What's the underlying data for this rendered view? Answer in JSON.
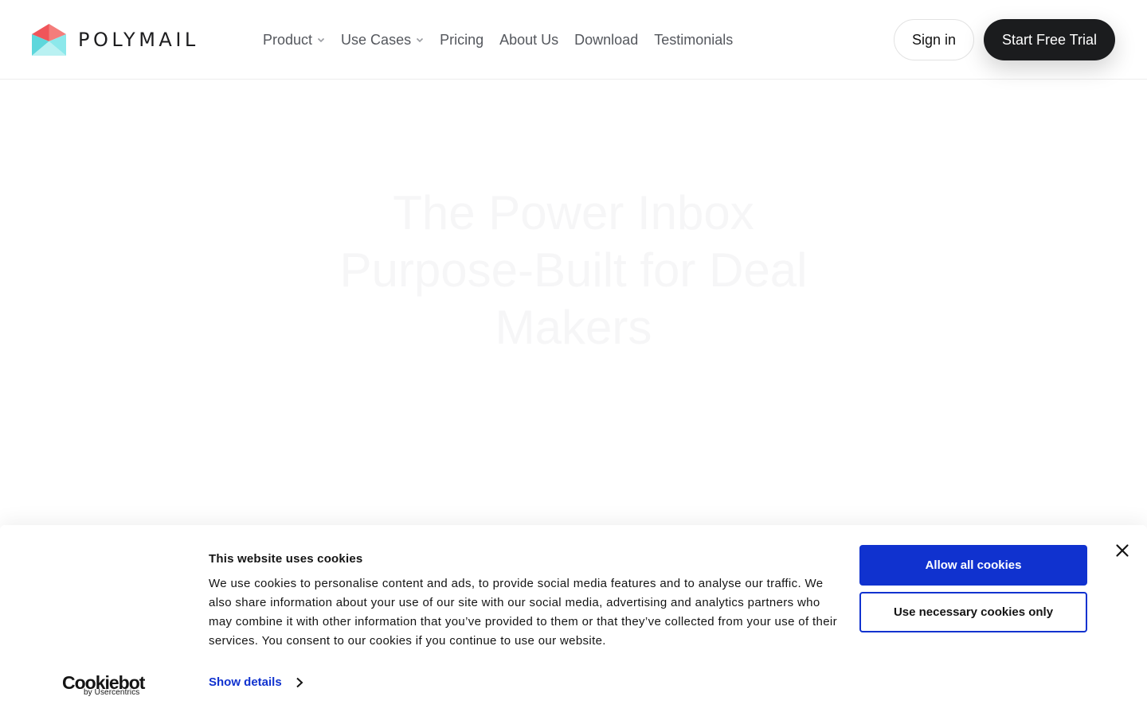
{
  "brand": {
    "name": "POLYMAIL",
    "colors": {
      "red": "#f0555a",
      "coral": "#f47d7b",
      "cyan": "#7ee6ea",
      "teal": "#5dd7dc"
    }
  },
  "nav": {
    "items": [
      {
        "label": "Product",
        "has_dropdown": true
      },
      {
        "label": "Use Cases",
        "has_dropdown": true
      },
      {
        "label": "Pricing",
        "has_dropdown": false
      },
      {
        "label": "About Us",
        "has_dropdown": false
      },
      {
        "label": "Download",
        "has_dropdown": false
      },
      {
        "label": "Testimonials",
        "has_dropdown": false
      }
    ],
    "signin_label": "Sign in",
    "trial_label": "Start Free Trial"
  },
  "hero": {
    "title": "The Power Inbox Purpose-Built for Deal Makers"
  },
  "cookie_banner": {
    "title": "This website uses cookies",
    "body": "We use cookies to personalise content and ads, to provide social media features and to analyse our traffic. We also share information about your use of our site with our social media, advertising and analytics partners who may combine it with other information that you’ve provided to them or that they’ve collected from your use of their services. You consent to our cookies if you continue to use our website.",
    "show_details_label": "Show details",
    "allow_all_label": "Allow all cookies",
    "necessary_only_label": "Use necessary cookies only",
    "provider_name": "Cookiebot",
    "provider_by": "by Usercentrics",
    "accent_color": "#1032cf"
  }
}
